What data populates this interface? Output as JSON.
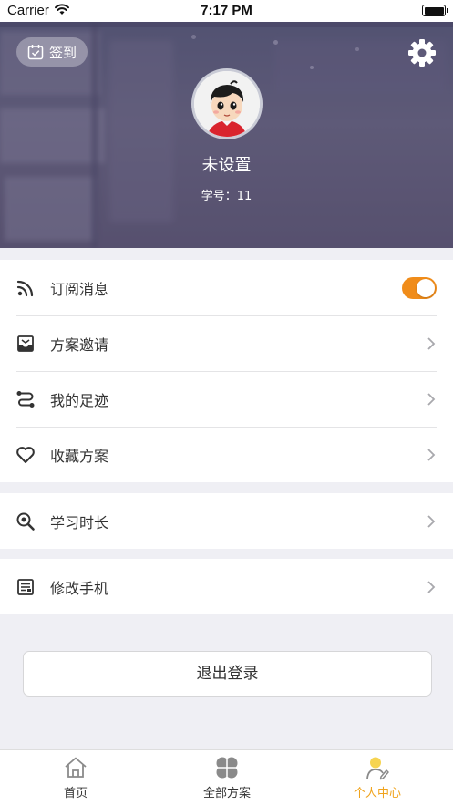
{
  "status_bar": {
    "carrier": "Carrier",
    "time": "7:17 PM"
  },
  "header": {
    "checkin_label": "签到",
    "username": "未设置",
    "student_id": "学号：11"
  },
  "menu": {
    "group1": [
      {
        "label": "订阅消息",
        "icon": "rss-icon",
        "control": "toggle",
        "toggle_on": true
      },
      {
        "label": "方案邀请",
        "icon": "inbox-icon",
        "control": "chevron"
      },
      {
        "label": "我的足迹",
        "icon": "route-icon",
        "control": "chevron"
      },
      {
        "label": "收藏方案",
        "icon": "heart-icon",
        "control": "chevron"
      }
    ],
    "group2": [
      {
        "label": "学习时长",
        "icon": "search-icon",
        "control": "chevron"
      }
    ],
    "group3": [
      {
        "label": "修改手机",
        "icon": "document-icon",
        "control": "chevron"
      }
    ]
  },
  "logout_label": "退出登录",
  "tabbar": {
    "tabs": [
      {
        "label": "首页",
        "icon": "home-icon",
        "active": false
      },
      {
        "label": "全部方案",
        "icon": "clover-icon",
        "active": false
      },
      {
        "label": "个人中心",
        "icon": "user-icon",
        "active": true
      }
    ]
  },
  "colors": {
    "accent": "#f0a31c",
    "toggle": "#f08c1a",
    "header_tint": "#5e5a78"
  }
}
